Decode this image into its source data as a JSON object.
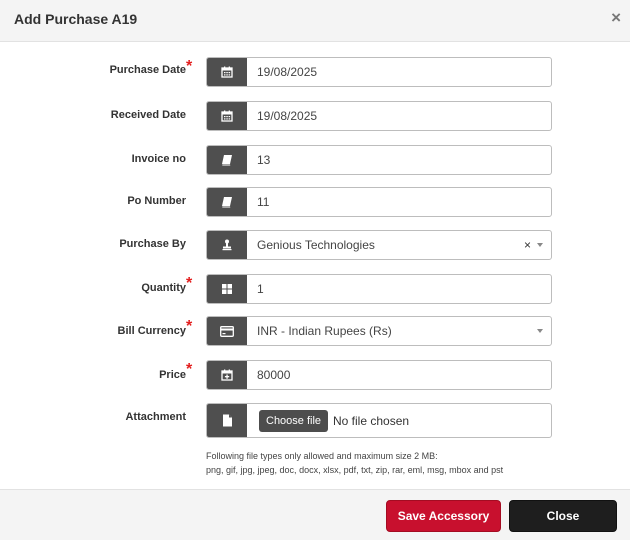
{
  "dialog": {
    "title": "Add Purchase A19",
    "close_icon": "close-x-icon"
  },
  "form": {
    "purchase_date": {
      "label": "Purchase Date",
      "required": true,
      "icon": "calendar-icon",
      "value": "19/08/2025"
    },
    "received_date": {
      "label": "Received Date",
      "required": false,
      "icon": "calendar-icon",
      "value": "19/08/2025"
    },
    "invoice_no": {
      "label": "Invoice no",
      "required": false,
      "icon": "book-icon",
      "value": "13"
    },
    "po_number": {
      "label": "Po Number",
      "required": false,
      "icon": "book-icon",
      "value": "11"
    },
    "purchase_by": {
      "label": "Purchase By",
      "required": false,
      "icon": "stamp-icon",
      "value": "Genious Technologies",
      "clear": "×"
    },
    "quantity": {
      "label": "Quantity",
      "required": true,
      "icon": "grid-icon",
      "value": "1"
    },
    "bill_currency": {
      "label": "Bill Currency",
      "required": true,
      "icon": "credit-card-icon",
      "value": "INR - Indian Rupees (Rs)"
    },
    "price": {
      "label": "Price",
      "required": true,
      "icon": "calendar-plus-icon",
      "value": "80000"
    },
    "attachment": {
      "label": "Attachment",
      "required": false,
      "icon": "file-icon",
      "button": "Choose file",
      "status": "No file chosen"
    }
  },
  "hint": {
    "line1": "Following file types only allowed and maximum size 2 MB:",
    "line2": "png, gif, jpg, jpeg, doc, docx, xlsx, pdf, txt, zip, rar, eml, msg, mbox and pst"
  },
  "footer": {
    "save_label": "Save Accessory",
    "close_label": "Close"
  },
  "required_mark": "*",
  "colors": {
    "save": "#c8102e",
    "close": "#1e1e1e",
    "addon": "#4f4f4f",
    "required": "#e31d1d"
  }
}
